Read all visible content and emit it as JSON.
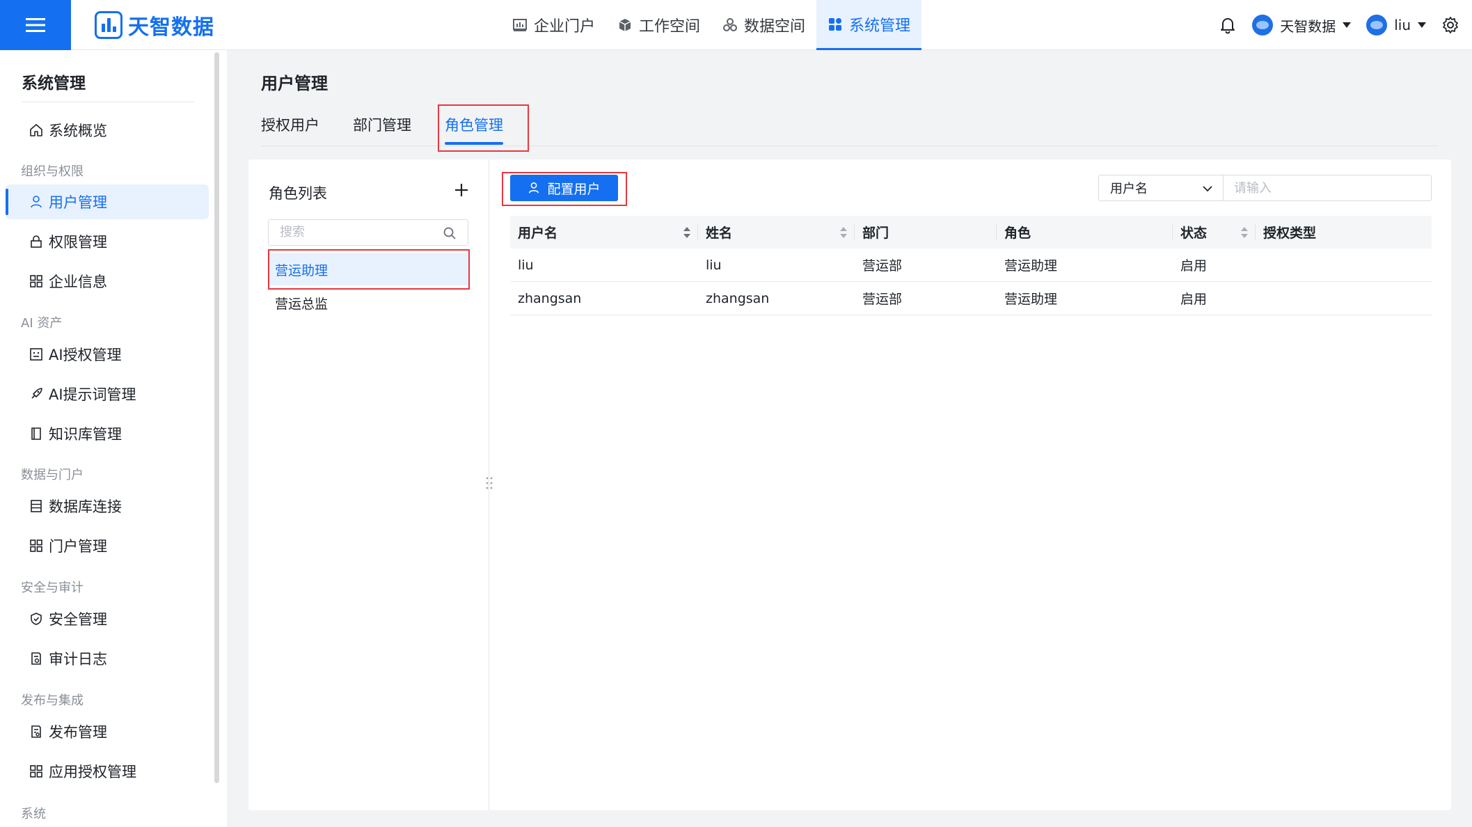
{
  "colors": {
    "accent": "#1470f0",
    "highlight": "#e8363f"
  },
  "header": {
    "logo_text": "天智数据",
    "nav": [
      {
        "label": "企业门户",
        "icon": "dashboard-icon"
      },
      {
        "label": "工作空间",
        "icon": "cube-icon"
      },
      {
        "label": "数据空间",
        "icon": "cluster-icon"
      },
      {
        "label": "系统管理",
        "icon": "apps-icon",
        "active": true
      }
    ],
    "org_label": "天智数据",
    "user_label": "liu"
  },
  "sidebar": {
    "title": "系统管理",
    "overview": "系统概览",
    "groups": [
      {
        "label": "组织与权限",
        "items": [
          {
            "label": "用户管理",
            "icon": "user-icon",
            "active": true
          },
          {
            "label": "权限管理",
            "icon": "lock-icon"
          },
          {
            "label": "企业信息",
            "icon": "grid-icon"
          }
        ]
      },
      {
        "label": "AI 资产",
        "items": [
          {
            "label": "AI授权管理",
            "icon": "ai-badge-icon"
          },
          {
            "label": "AI提示词管理",
            "icon": "rocket-icon"
          },
          {
            "label": "知识库管理",
            "icon": "book-icon"
          }
        ]
      },
      {
        "label": "数据与门户",
        "items": [
          {
            "label": "数据库连接",
            "icon": "database-icon"
          },
          {
            "label": "门户管理",
            "icon": "grid-icon"
          }
        ]
      },
      {
        "label": "安全与审计",
        "items": [
          {
            "label": "安全管理",
            "icon": "shield-icon"
          },
          {
            "label": "审计日志",
            "icon": "audit-doc-icon"
          }
        ]
      },
      {
        "label": "发布与集成",
        "items": [
          {
            "label": "发布管理",
            "icon": "publish-doc-icon"
          },
          {
            "label": "应用授权管理",
            "icon": "grid-icon"
          }
        ]
      },
      {
        "label": "系统",
        "items": []
      }
    ]
  },
  "main": {
    "title": "用户管理",
    "tabs": [
      {
        "label": "授权用户"
      },
      {
        "label": "部门管理"
      },
      {
        "label": "角色管理",
        "active": true
      }
    ],
    "role_list": {
      "title": "角色列表",
      "search_placeholder": "搜索",
      "roles": [
        {
          "label": "营运助理",
          "active": true
        },
        {
          "label": "营运总监"
        }
      ]
    },
    "toolbar": {
      "config_button": "配置用户",
      "filter_field": "用户名",
      "filter_placeholder": "请输入"
    },
    "table": {
      "columns": [
        "用户名",
        "姓名",
        "部门",
        "角色",
        "状态",
        "授权类型"
      ],
      "rows": [
        [
          "liu",
          "liu",
          "营运部",
          "营运助理",
          "启用",
          ""
        ],
        [
          "zhangsan",
          "zhangsan",
          "营运部",
          "营运助理",
          "启用",
          ""
        ]
      ]
    }
  }
}
